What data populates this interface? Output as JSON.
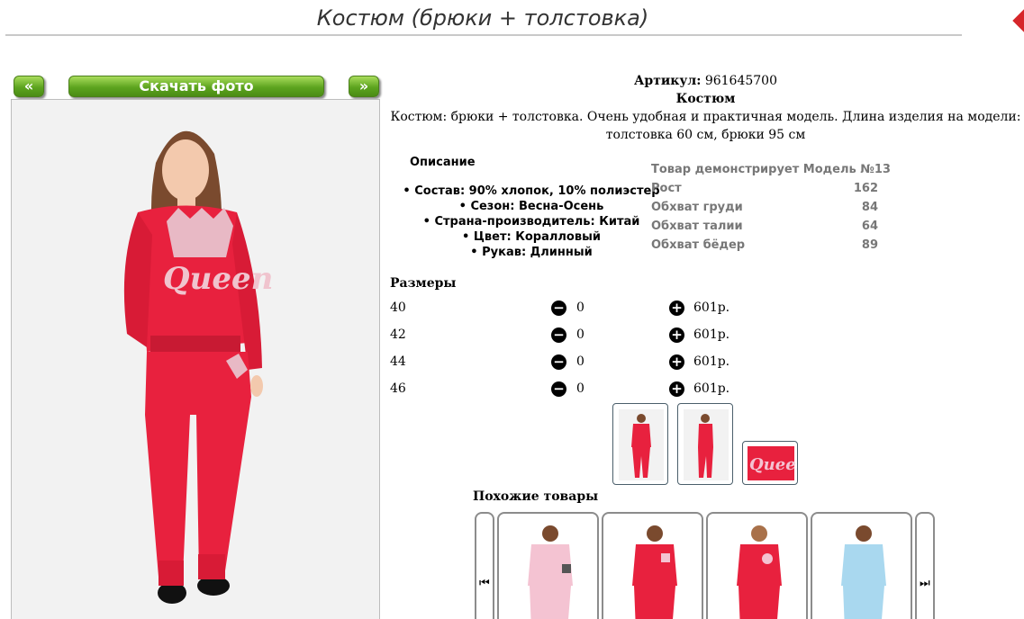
{
  "page": {
    "title": "Костюм (брюки + толстовка)"
  },
  "photo_nav": {
    "prev_label": "«",
    "download_label": "Скачать фото",
    "next_label": "»"
  },
  "product": {
    "article_label": "Артикул:",
    "article_value": "961645700",
    "name": "Костюм",
    "description": "Костюм: брюки + толстовка. Очень удобная и практичная модель. Длина изделия на модели: толстовка 60 см, брюки 95 см"
  },
  "details": {
    "heading": "Описание",
    "features": [
      "Состав: 90% хлопок, 10% полиэстер",
      "Сезон: Весна-Осень",
      "Страна-производитель: Китай",
      "Цвет: Коралловый",
      "Рукав: Длинный"
    ]
  },
  "model": {
    "title": "Товар демонстрирует Модель №13",
    "rows": [
      {
        "label": "Рост",
        "value": "162"
      },
      {
        "label": "Обхват груди",
        "value": "84"
      },
      {
        "label": "Обхват талии",
        "value": "64"
      },
      {
        "label": "Обхват бёдер",
        "value": "89"
      }
    ]
  },
  "sizes": {
    "heading": "Размеры",
    "rows": [
      {
        "size": "40",
        "qty": "0",
        "price": "601р."
      },
      {
        "size": "42",
        "qty": "0",
        "price": "601р."
      },
      {
        "size": "44",
        "qty": "0",
        "price": "601р."
      },
      {
        "size": "46",
        "qty": "0",
        "price": "601р."
      }
    ],
    "minus_icon": "minus-circle-icon",
    "plus_icon": "plus-circle-icon"
  },
  "thumbnails": {
    "logo_text": "Queen"
  },
  "similar": {
    "heading": "Похожие товары"
  },
  "colors": {
    "suit_red": "#e8213e",
    "light_pink": "#f4c3d2",
    "light_blue": "#a9d8ef",
    "button_green": "#5da41f"
  }
}
